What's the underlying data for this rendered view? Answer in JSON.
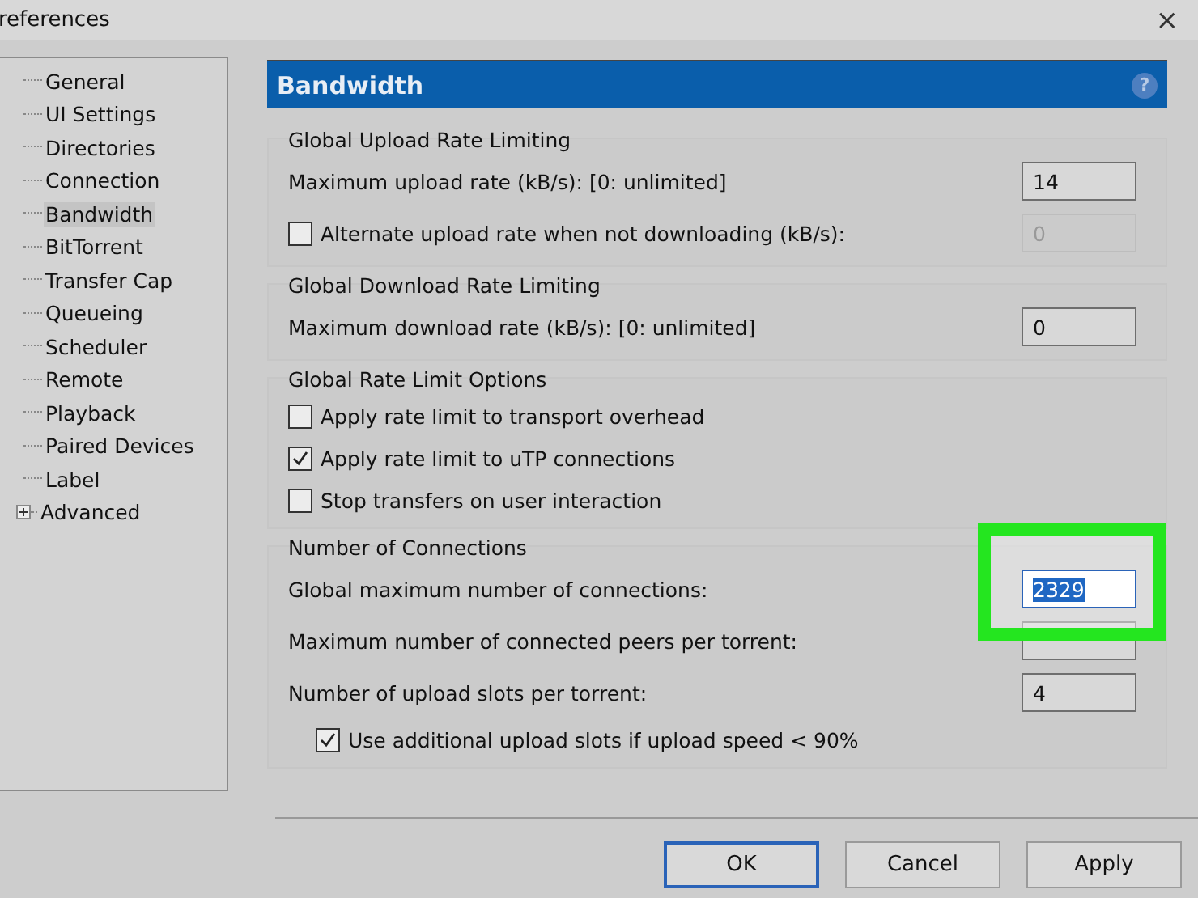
{
  "window": {
    "title": "references",
    "close": "×"
  },
  "sidebar": {
    "items": [
      {
        "label": "General",
        "selected": false,
        "kind": "leaf"
      },
      {
        "label": "UI Settings",
        "selected": false,
        "kind": "leaf"
      },
      {
        "label": "Directories",
        "selected": false,
        "kind": "leaf"
      },
      {
        "label": "Connection",
        "selected": false,
        "kind": "leaf"
      },
      {
        "label": "Bandwidth",
        "selected": true,
        "kind": "leaf"
      },
      {
        "label": "BitTorrent",
        "selected": false,
        "kind": "leaf"
      },
      {
        "label": "Transfer Cap",
        "selected": false,
        "kind": "leaf"
      },
      {
        "label": "Queueing",
        "selected": false,
        "kind": "leaf"
      },
      {
        "label": "Scheduler",
        "selected": false,
        "kind": "leaf"
      },
      {
        "label": "Remote",
        "selected": false,
        "kind": "leaf"
      },
      {
        "label": "Playback",
        "selected": false,
        "kind": "leaf"
      },
      {
        "label": "Paired Devices",
        "selected": false,
        "kind": "leaf"
      },
      {
        "label": "Label",
        "selected": false,
        "kind": "leaf"
      },
      {
        "label": "Advanced",
        "selected": false,
        "kind": "folder"
      }
    ]
  },
  "panel": {
    "title": "Bandwidth",
    "help": "?"
  },
  "groups": [
    {
      "title": "Global Upload Rate Limiting",
      "rows": [
        {
          "kind": "field",
          "label": "Maximum upload rate (kB/s): [0: unlimited]",
          "value": "14",
          "disabled": false,
          "highlighted": false,
          "text_selected": false
        },
        {
          "kind": "check_field",
          "label": "Alternate upload rate when not downloading (kB/s):",
          "checked": false,
          "value": "0",
          "disabled": true,
          "highlighted": false,
          "text_selected": false
        }
      ]
    },
    {
      "title": "Global Download Rate Limiting",
      "rows": [
        {
          "kind": "field",
          "label": "Maximum download rate (kB/s): [0: unlimited]",
          "value": "0",
          "disabled": false,
          "highlighted": false,
          "text_selected": false
        }
      ]
    },
    {
      "title": "Global Rate Limit Options",
      "rows": [
        {
          "kind": "check",
          "label": "Apply rate limit to transport overhead",
          "checked": false
        },
        {
          "kind": "check",
          "label": "Apply rate limit to uTP connections",
          "checked": true
        },
        {
          "kind": "check",
          "label": "Stop transfers on user interaction",
          "checked": false
        }
      ]
    },
    {
      "title": "Number of Connections",
      "rows": [
        {
          "kind": "field",
          "label": "Global maximum number of connections:",
          "value": "2329",
          "disabled": false,
          "highlighted": true,
          "text_selected": true
        },
        {
          "kind": "field",
          "label": "Maximum number of connected peers per torrent:",
          "disabled": false,
          "highlighted": false
        },
        {
          "kind": "field",
          "label": "Number of upload slots per torrent:",
          "value": "4",
          "disabled": false,
          "highlighted": false,
          "text_selected": false
        },
        {
          "kind": "subcheck",
          "label": "Use additional upload slots if upload speed < 90%",
          "checked": true
        }
      ]
    }
  ],
  "buttons": [
    {
      "label": "OK",
      "default": true
    },
    {
      "label": "Cancel",
      "default": false
    },
    {
      "label": "Apply",
      "default": false
    }
  ]
}
